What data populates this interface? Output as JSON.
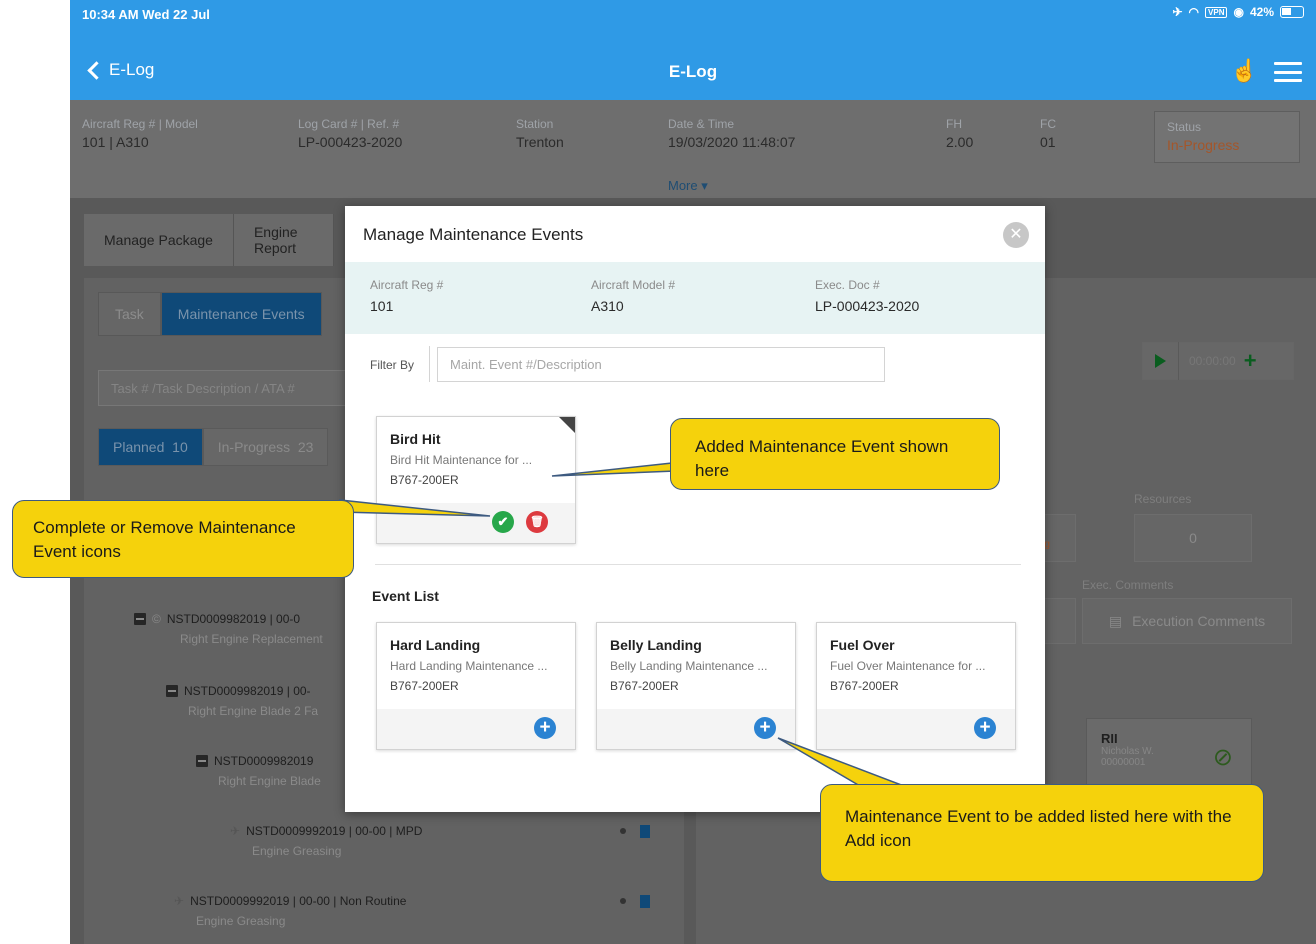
{
  "status_bar": {
    "time": "10:34 AM  Wed 22 Jul",
    "vpn": "VPN",
    "battery": "42%"
  },
  "nav": {
    "back_label": "E-Log",
    "title": "E-Log"
  },
  "info": {
    "aircraft_label": "Aircraft Reg # | Model",
    "aircraft_value": "101 | A310",
    "logcard_label": "Log Card # | Ref. #",
    "logcard_value": "LP-000423-2020",
    "station_label": "Station",
    "station_value": "Trenton",
    "datetime_label": "Date & Time",
    "datetime_value": "19/03/2020  11:48:07",
    "fh_label": "FH",
    "fh_value": "2.00",
    "fc_label": "FC",
    "fc_value": "01",
    "status_label": "Status",
    "status_value": "In-Progress",
    "more": "More ▾"
  },
  "breadcrumb": {
    "item1": "Manage Package",
    "item2": "Engine Report"
  },
  "left": {
    "tab_task": "Task",
    "tab_events": "Maintenance Events",
    "search_placeholder": "Task # /Task Description / ATA #",
    "pill_planned": "Planned",
    "pill_planned_count": "10",
    "pill_inprogress": "In-Progress",
    "pill_inprogress_count": "23",
    "rows": [
      {
        "id": "NSTD0009982019 | 00-0",
        "desc": "Right Engine Replacement"
      },
      {
        "id": "NSTD0009982019 | 00-",
        "desc": "Right Engine Blade 2 Fa"
      },
      {
        "id": "NSTD0009982019",
        "desc": "Right Engine Blade"
      },
      {
        "id": "NSTD0009992019 | 00-00 | MPD",
        "desc": "Engine Greasing"
      },
      {
        "id": "NSTD0009992019 | 00-00 | Non Routine",
        "desc": "Engine Greasing"
      }
    ]
  },
  "right": {
    "timer": "00:00:00",
    "resources_label": "Resources",
    "resources_value": "0",
    "partial_value": "/0",
    "partial_status": "ding",
    "partial_label": "m.",
    "exec_label": "Exec. Comments",
    "exec_button": "Execution Comments",
    "rii_title": "RII",
    "rii_name": "Nicholas W.",
    "rii_id": "00000001"
  },
  "modal": {
    "title": "Manage Maintenance Events",
    "reg_label": "Aircraft Reg #",
    "reg_value": "101",
    "model_label": "Aircraft Model #",
    "model_value": "A310",
    "doc_label": "Exec. Doc #",
    "doc_value": "LP-000423-2020",
    "filter_label": "Filter By",
    "filter_placeholder": "Maint. Event #/Description",
    "added": {
      "title": "Bird Hit",
      "desc": "Bird Hit Maintenance for ...",
      "model": "B767-200ER"
    },
    "event_list_title": "Event List",
    "events": [
      {
        "title": "Hard Landing",
        "desc": "Hard Landing Maintenance ...",
        "model": "B767-200ER"
      },
      {
        "title": "Belly Landing",
        "desc": "Belly Landing Maintenance ...",
        "model": "B767-200ER"
      },
      {
        "title": "Fuel Over",
        "desc": "Fuel Over Maintenance for ...",
        "model": "B767-200ER"
      }
    ]
  },
  "callouts": {
    "added": "Added Maintenance Event shown here",
    "icons": "Complete or Remove Maintenance Event icons",
    "list": "Maintenance Event to be added listed here with the Add icon"
  },
  "colors": {
    "header_blue": "#2f9ae6",
    "callout_yellow": "#f5d20c",
    "add_blue": "#2b83d2",
    "complete_green": "#27a74a",
    "remove_red": "#dd3a3f"
  }
}
